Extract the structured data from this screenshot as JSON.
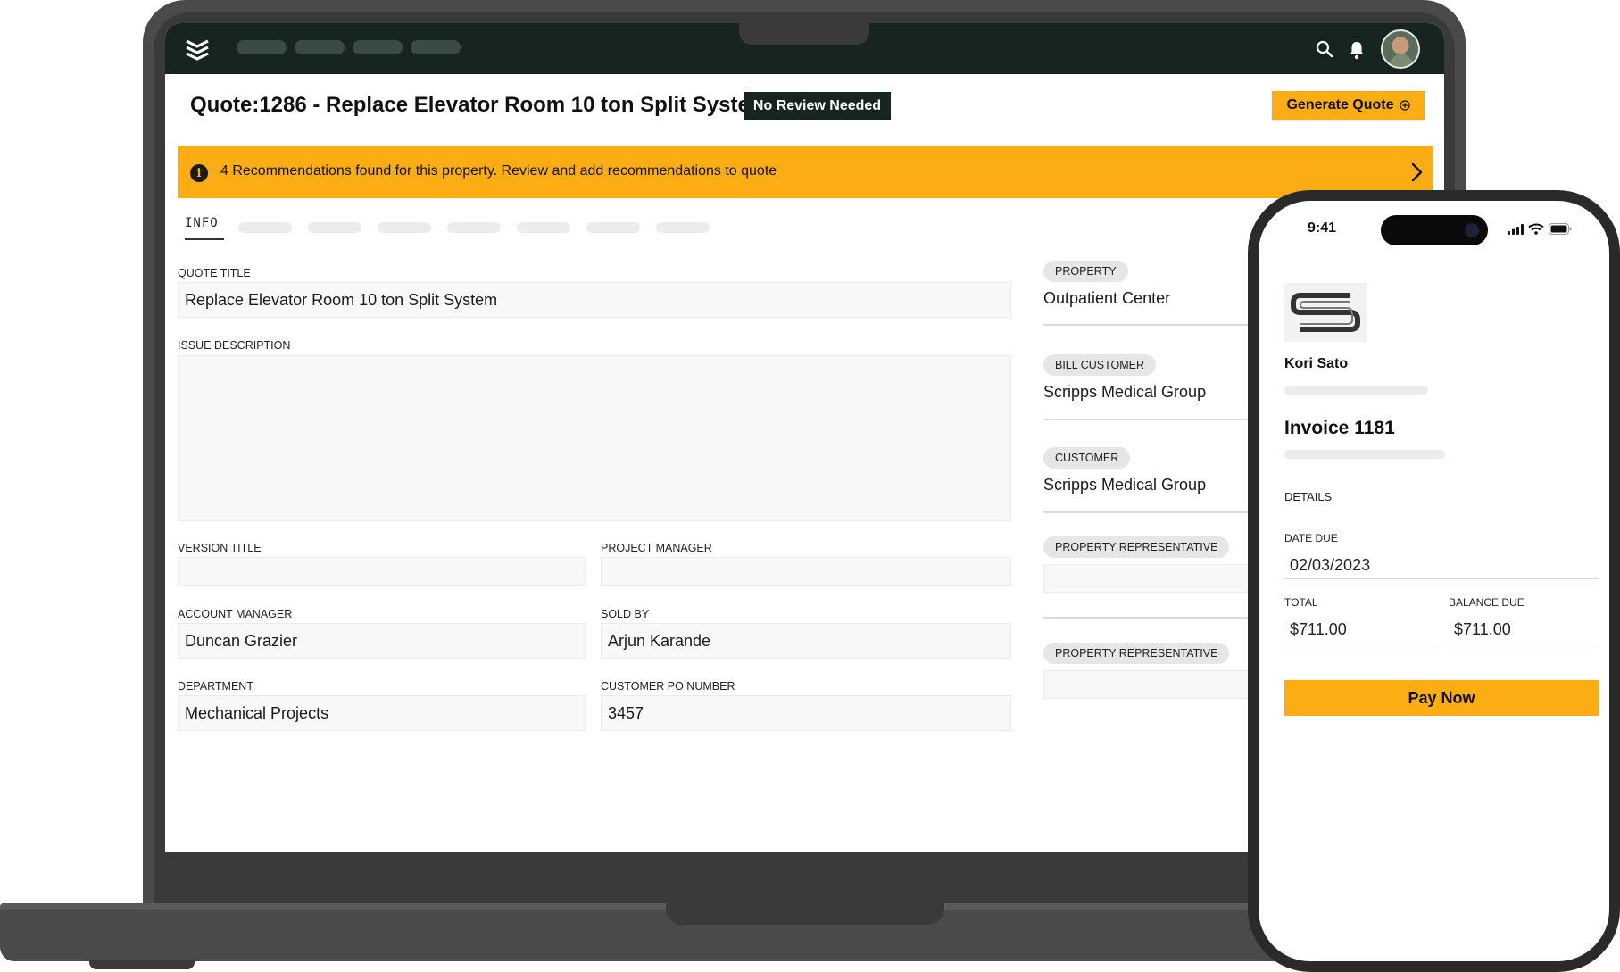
{
  "app": {
    "nav_icons": [
      "layers-logo-icon",
      "search-icon",
      "bell-icon"
    ],
    "accent_color": "#fdad14",
    "dark_color": "#172520"
  },
  "header": {
    "title": "Quote:1286 - Replace Elevator Room 10 ton Split System",
    "status_badge": "No Review Needed",
    "generate_button": "Generate Quote"
  },
  "banner": {
    "text": "4 Recommendations found for this property. Review and add recommendations to quote"
  },
  "tabs": {
    "active": "INFO"
  },
  "form": {
    "quote_title": {
      "label": "QUOTE TITLE",
      "value": "Replace Elevator Room 10 ton Split System"
    },
    "issue_description": {
      "label": "ISSUE DESCRIPTION",
      "value": ""
    },
    "version_title": {
      "label": "VERSION TITLE",
      "value": ""
    },
    "project_manager": {
      "label": "PROJECT MANAGER",
      "value": ""
    },
    "account_manager": {
      "label": "ACCOUNT MANAGER",
      "value": "Duncan Grazier"
    },
    "sold_by": {
      "label": "SOLD BY",
      "value": "Arjun Karande"
    },
    "department": {
      "label": "DEPARTMENT",
      "value": "Mechanical Projects"
    },
    "customer_po": {
      "label": "CUSTOMER PO NUMBER",
      "value": "3457"
    }
  },
  "side": {
    "property": {
      "label": "PROPERTY",
      "value": "Outpatient Center"
    },
    "bill_customer": {
      "label": "BILL CUSTOMER",
      "value": "Scripps Medical Group"
    },
    "customer": {
      "label": "CUSTOMER",
      "value": "Scripps Medical Group"
    },
    "property_rep_1": {
      "label": "PROPERTY REPRESENTATIVE"
    },
    "property_rep_2": {
      "label": "PROPERTY REPRESENTATIVE"
    }
  },
  "phone": {
    "time": "9:41",
    "customer_name": "Kori Sato",
    "invoice_title": "Invoice 1181",
    "details_label": "DETAILS",
    "date_due_label": "DATE DUE",
    "date_due": "02/03/2023",
    "total_label": "TOTAL",
    "total": "$711.00",
    "balance_due_label": "BALANCE DUE",
    "balance_due": "$711.00",
    "pay_button": "Pay Now"
  }
}
